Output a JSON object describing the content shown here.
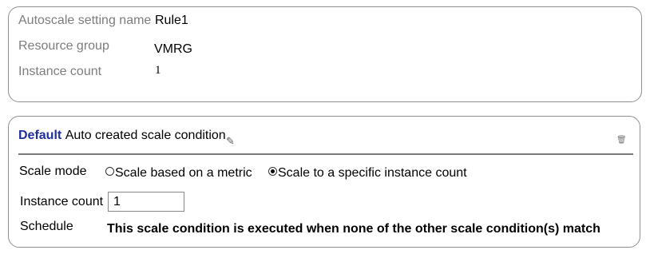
{
  "summary": {
    "setting_name_label": "Autoscale setting name",
    "setting_name_value": "Rule1",
    "resource_group_label": "Resource group",
    "resource_group_value": "VMRG",
    "instance_count_label": "Instance count",
    "instance_count_value": "1"
  },
  "condition": {
    "title_prefix": "Default",
    "title_text": "Auto created scale condition",
    "edit_icon": "✎",
    "delete_icon": "🗑",
    "scale_mode_label": "Scale mode",
    "scale_mode_options": [
      {
        "label": "Scale based on a metric",
        "selected": false
      },
      {
        "label": "Scale to a specific instance count",
        "selected": true
      }
    ],
    "instance_count_label": "Instance count",
    "instance_count_value": "1",
    "schedule_label": "Schedule",
    "schedule_text": "This scale condition is executed when none of the other scale condition(s) match"
  }
}
